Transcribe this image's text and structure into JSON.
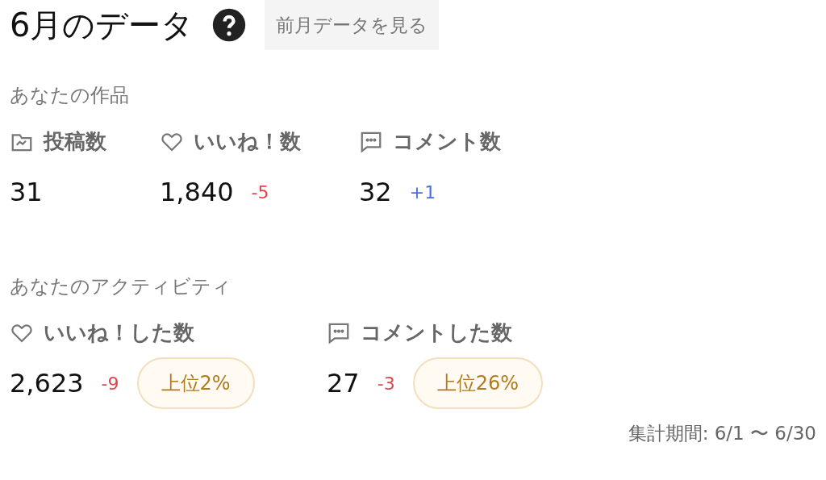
{
  "header": {
    "title": "6月のデータ",
    "help_icon": true,
    "previous_button": "前月データを見る"
  },
  "works": {
    "label": "あなたの作品",
    "stats": [
      {
        "kind": "posts",
        "label": "投稿数",
        "value": "31"
      },
      {
        "kind": "heart",
        "label": "いいね！数",
        "value": "1,840",
        "delta": {
          "text": "-5",
          "kind": "decrease"
        }
      },
      {
        "kind": "comment",
        "label": "コメント数",
        "value": "32",
        "delta": {
          "text": "+1",
          "kind": "increase"
        }
      }
    ]
  },
  "activity": {
    "label": "あなたのアクティビティ",
    "stats": [
      {
        "kind": "heart",
        "label": "いいね！した数",
        "value": "2,623",
        "delta": {
          "text": "-9",
          "kind": "decrease"
        },
        "rank": "上位2%"
      },
      {
        "kind": "comment",
        "label": "コメントした数",
        "value": "27",
        "delta": {
          "text": "-3",
          "kind": "decrease"
        },
        "rank": "上位26%"
      }
    ]
  },
  "footer": {
    "period": "集計期間: 6/1 〜 6/30"
  }
}
